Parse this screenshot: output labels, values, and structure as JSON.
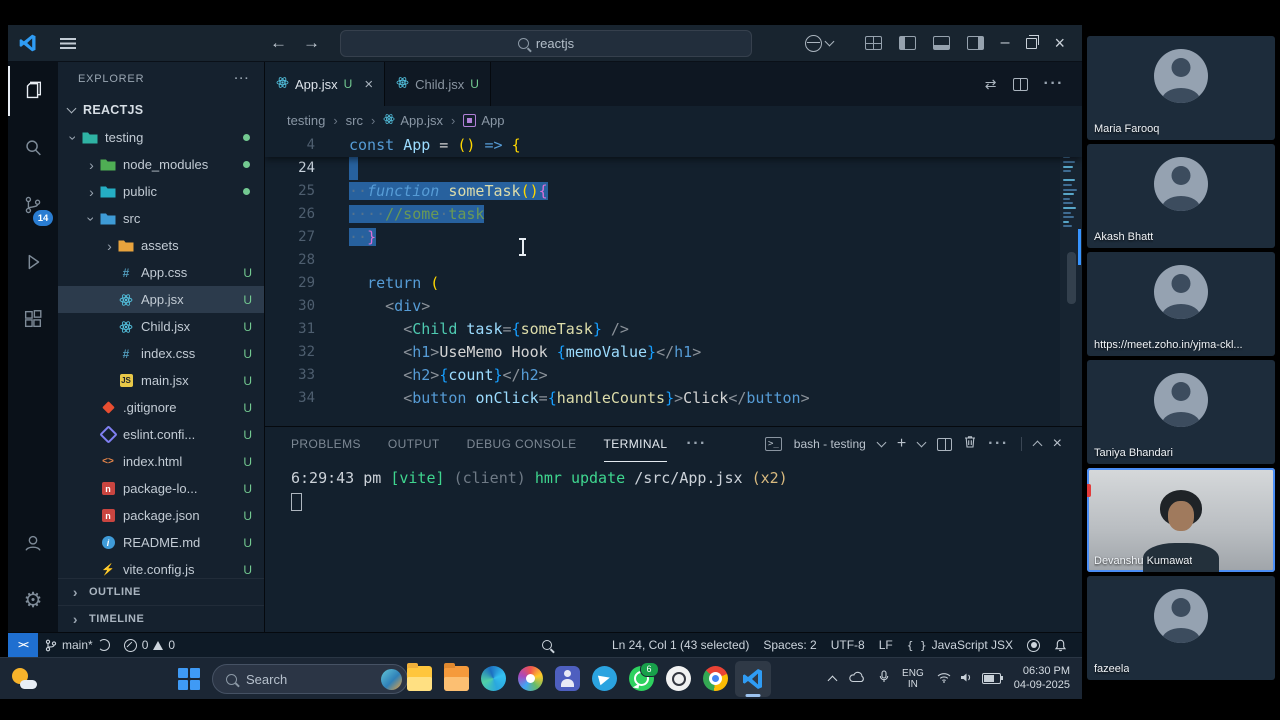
{
  "titlebar": {
    "search": "reactjs"
  },
  "activity_bar": {
    "items": [
      {
        "name": "explorer",
        "active": true
      },
      {
        "name": "search"
      },
      {
        "name": "source-control",
        "badge": "14"
      },
      {
        "name": "run-debug"
      },
      {
        "name": "extensions"
      }
    ],
    "bottom": [
      {
        "name": "account"
      },
      {
        "name": "settings"
      }
    ]
  },
  "explorer": {
    "title": "EXPLORER",
    "workspace": "REACTJS",
    "files": [
      {
        "label": "testing",
        "type": "folder",
        "depth": 0,
        "expanded": true,
        "badge": "dot",
        "color": "#2fb3a4"
      },
      {
        "label": "node_modules",
        "type": "folder",
        "depth": 1,
        "expanded": false,
        "badge": "dot",
        "color": "#4fae54"
      },
      {
        "label": "public",
        "type": "folder",
        "depth": 1,
        "expanded": false,
        "badge": "dot",
        "color": "#25aec4"
      },
      {
        "label": "src",
        "type": "folder",
        "depth": 1,
        "expanded": true,
        "badge": "",
        "color": "#3e9bd6"
      },
      {
        "label": "assets",
        "type": "folder",
        "depth": 2,
        "expanded": false,
        "badge": "",
        "color": "#e8a33d"
      },
      {
        "label": "App.css",
        "icon": "css",
        "depth": 2,
        "badge": "U"
      },
      {
        "label": "App.jsx",
        "icon": "react",
        "depth": 2,
        "badge": "U",
        "selected": true
      },
      {
        "label": "Child.jsx",
        "icon": "react",
        "depth": 2,
        "badge": "U"
      },
      {
        "label": "index.css",
        "icon": "css",
        "depth": 2,
        "badge": "U"
      },
      {
        "label": "main.jsx",
        "icon": "js",
        "depth": 2,
        "badge": "U"
      },
      {
        "label": ".gitignore",
        "icon": "git",
        "depth": 1,
        "badge": "U"
      },
      {
        "label": "eslint.confi...",
        "icon": "eslint",
        "depth": 1,
        "badge": "U"
      },
      {
        "label": "index.html",
        "icon": "html",
        "depth": 1,
        "badge": "U"
      },
      {
        "label": "package-lo...",
        "icon": "npm",
        "depth": 1,
        "badge": "U"
      },
      {
        "label": "package.json",
        "icon": "npm",
        "depth": 1,
        "badge": "U"
      },
      {
        "label": "README.md",
        "icon": "readme",
        "depth": 1,
        "badge": "U"
      },
      {
        "label": "vite.config.js",
        "icon": "vite",
        "depth": 1,
        "badge": "U"
      }
    ],
    "sections": [
      {
        "label": "OUTLINE"
      },
      {
        "label": "TIMELINE"
      }
    ]
  },
  "editor": {
    "tabs": [
      {
        "label": "App.jsx",
        "badge": "U",
        "active": true
      },
      {
        "label": "Child.jsx",
        "badge": "U",
        "active": false
      }
    ],
    "breadcrumb": [
      {
        "label": "testing"
      },
      {
        "label": "src"
      },
      {
        "label": "App.jsx",
        "icon": "react"
      },
      {
        "label": "App",
        "icon": "symbol"
      }
    ],
    "sticky": {
      "number": "4",
      "tokens": [
        [
          "kw",
          "const "
        ],
        [
          "attr",
          "App"
        ],
        [
          "txt",
          " = "
        ],
        [
          "b1",
          "()"
        ],
        [
          "kw",
          " => "
        ],
        [
          "b1",
          "{"
        ]
      ]
    },
    "lines": [
      {
        "number": "24",
        "active": true,
        "selStart": true,
        "tokens": []
      },
      {
        "number": "25",
        "selected": true,
        "tokens": [
          [
            "ws",
            "··"
          ],
          [
            "kwi",
            "function "
          ],
          [
            "fn",
            "someTask"
          ],
          [
            "b1",
            "()"
          ],
          [
            "b2",
            "{"
          ]
        ]
      },
      {
        "number": "26",
        "selected": true,
        "tokens": [
          [
            "ws",
            "····"
          ],
          [
            "com",
            "//some"
          ],
          [
            "ws",
            "·"
          ],
          [
            "com",
            "task"
          ]
        ]
      },
      {
        "number": "27",
        "selected": true,
        "tokens": [
          [
            "ws",
            "··"
          ],
          [
            "b2",
            "}"
          ]
        ]
      },
      {
        "number": "28",
        "tokens": []
      },
      {
        "number": "29",
        "tokens": [
          [
            "ws",
            "  "
          ],
          [
            "kw",
            "return"
          ],
          [
            "txt",
            " "
          ],
          [
            "b1",
            "("
          ]
        ]
      },
      {
        "number": "30",
        "tokens": [
          [
            "ws",
            "    "
          ],
          [
            "pun",
            "<"
          ],
          [
            "tag",
            "div"
          ],
          [
            "pun",
            ">"
          ]
        ]
      },
      {
        "number": "31",
        "tokens": [
          [
            "ws",
            "      "
          ],
          [
            "pun",
            "<"
          ],
          [
            "cmp",
            "Child"
          ],
          [
            "txt",
            " "
          ],
          [
            "attr",
            "task"
          ],
          [
            "pun",
            "="
          ],
          [
            "b3",
            "{"
          ],
          [
            "fn",
            "someTask"
          ],
          [
            "b3",
            "}"
          ],
          [
            "txt",
            " "
          ],
          [
            "pun",
            "/>"
          ]
        ]
      },
      {
        "number": "32",
        "tokens": [
          [
            "ws",
            "      "
          ],
          [
            "pun",
            "<"
          ],
          [
            "tag",
            "h1"
          ],
          [
            "pun",
            ">"
          ],
          [
            "txt",
            "UseMemo Hook "
          ],
          [
            "b3",
            "{"
          ],
          [
            "var",
            "memoValue"
          ],
          [
            "b3",
            "}"
          ],
          [
            "pun",
            "</"
          ],
          [
            "tag",
            "h1"
          ],
          [
            "pun",
            ">"
          ]
        ]
      },
      {
        "number": "33",
        "tokens": [
          [
            "ws",
            "      "
          ],
          [
            "pun",
            "<"
          ],
          [
            "tag",
            "h2"
          ],
          [
            "pun",
            ">"
          ],
          [
            "b3",
            "{"
          ],
          [
            "var",
            "count"
          ],
          [
            "b3",
            "}"
          ],
          [
            "pun",
            "</"
          ],
          [
            "tag",
            "h2"
          ],
          [
            "pun",
            ">"
          ]
        ]
      },
      {
        "number": "34",
        "tokens": [
          [
            "ws",
            "      "
          ],
          [
            "pun",
            "<"
          ],
          [
            "tag",
            "button"
          ],
          [
            "txt",
            " "
          ],
          [
            "attr",
            "onClick"
          ],
          [
            "pun",
            "="
          ],
          [
            "b3",
            "{"
          ],
          [
            "fn",
            "handleCounts"
          ],
          [
            "b3",
            "}"
          ],
          [
            "pun",
            ">"
          ],
          [
            "txt",
            "Click"
          ],
          [
            "pun",
            "</"
          ],
          [
            "tag",
            "button"
          ],
          [
            "pun",
            ">"
          ]
        ]
      }
    ]
  },
  "panel": {
    "tabs": [
      {
        "label": "PROBLEMS"
      },
      {
        "label": "OUTPUT"
      },
      {
        "label": "DEBUG CONSOLE"
      },
      {
        "label": "TERMINAL",
        "active": true
      }
    ],
    "shell_label": "bash - testing",
    "terminal_line": [
      [
        "t1",
        "6:29:43 pm "
      ],
      [
        "tg",
        "[vite] "
      ],
      [
        "td",
        "(client) "
      ],
      [
        "tg",
        "hmr update "
      ],
      [
        "t1",
        "/src/App.jsx "
      ],
      [
        "ty",
        "(x2)"
      ]
    ]
  },
  "status_bar": {
    "remote_glyph": "><",
    "branch": "main*",
    "errors": "0",
    "warnings": "0",
    "line_col": "Ln 24, Col 1 (43 selected)",
    "indent": "Spaces: 2",
    "encoding": "UTF-8",
    "eol": "LF",
    "language_glyph": "{ }",
    "language": "JavaScript JSX"
  },
  "taskbar": {
    "search_label": "Search",
    "apps": [
      {
        "name": "file-explorer"
      },
      {
        "name": "folder"
      },
      {
        "name": "edge"
      },
      {
        "name": "photos"
      },
      {
        "name": "teams"
      },
      {
        "name": "telegram"
      },
      {
        "name": "whatsapp",
        "badge": "6"
      },
      {
        "name": "chatgpt"
      },
      {
        "name": "chrome"
      },
      {
        "name": "vscode",
        "active": true
      }
    ],
    "tray": {
      "lang_line1": "ENG",
      "lang_line2": "IN",
      "time": "06:30 PM",
      "date": "04-09-2025"
    }
  },
  "meeting": {
    "participants": [
      {
        "name": "Maria Farooq",
        "type": "avatar"
      },
      {
        "name": "Akash Bhatt",
        "type": "avatar"
      },
      {
        "name": "https://meet.zoho.in/yjma-ckl...",
        "type": "avatar"
      },
      {
        "name": "Taniya Bhandari",
        "type": "avatar"
      },
      {
        "name": "Devanshu Kumawat",
        "type": "video",
        "active": true
      },
      {
        "name": "fazeela",
        "type": "avatar"
      }
    ]
  }
}
